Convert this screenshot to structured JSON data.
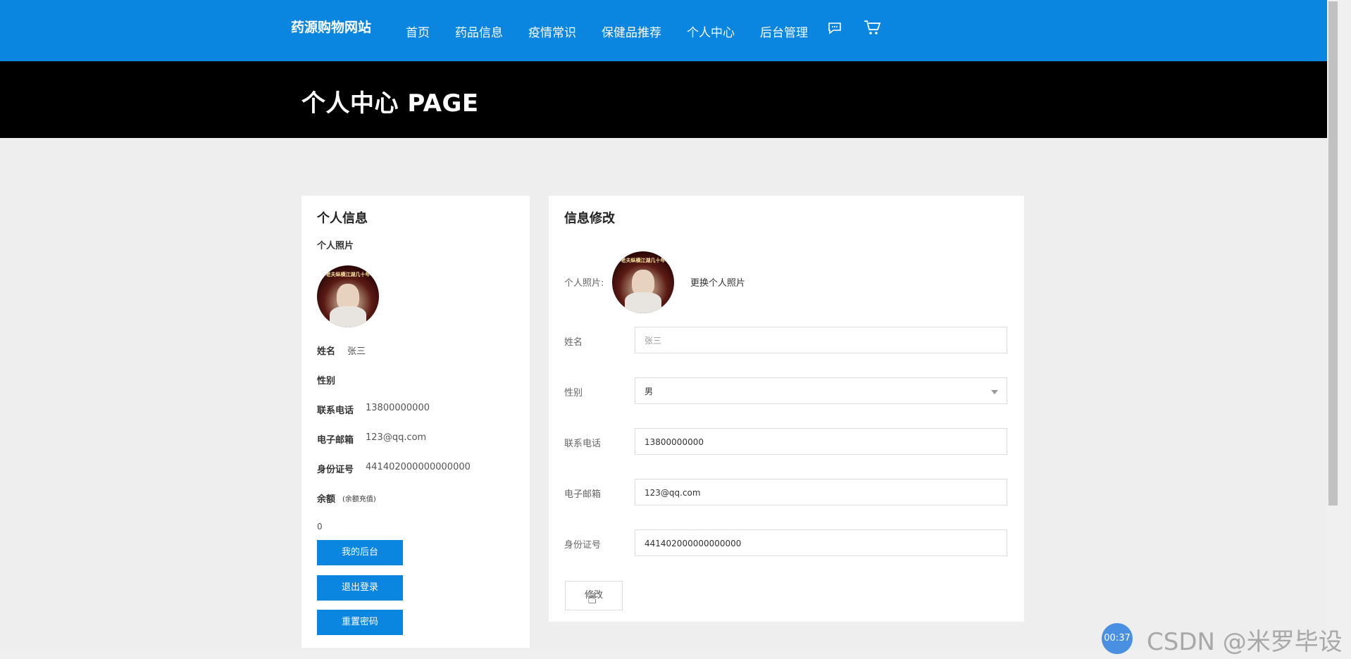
{
  "header": {
    "brand": "药源购物网站",
    "nav": [
      "首页",
      "药品信息",
      "疫情常识",
      "保健品推荐",
      "个人中心",
      "后台管理"
    ],
    "icons": [
      "chat-icon",
      "cart-icon"
    ]
  },
  "banner": {
    "title": "个人中心 PAGE"
  },
  "profile": {
    "title": "个人信息",
    "photo_label": "个人照片",
    "avatar_caption": "老夫纵横江湖几十年",
    "name_label": "姓名",
    "name": "张三",
    "gender_label": "性别",
    "gender": "",
    "phone_label": "联系电话",
    "phone": "13800000000",
    "email_label": "电子邮箱",
    "email": "123@qq.com",
    "id_label": "身份证号",
    "id": "441402000000000000",
    "balance_label": "余额",
    "recharge_link": "(余额充值)",
    "balance": "0",
    "buttons": {
      "backend": "我的后台",
      "logout": "退出登录",
      "reset": "重置密码"
    }
  },
  "edit": {
    "title": "信息修改",
    "photo_label": "个人照片:",
    "change_photo": "更换个人照片",
    "name_label": "姓名",
    "name_placeholder": "张三",
    "gender_label": "性别",
    "gender_value": "男",
    "phone_label": "联系电话",
    "phone_value": "13800000000",
    "email_label": "电子邮箱",
    "email_value": "123@qq.com",
    "id_label": "身份证号",
    "id_value": "441402000000000000",
    "submit": "修改"
  },
  "overlay": {
    "timer": "00:37",
    "watermark": "CSDN @米罗毕设"
  },
  "colors": {
    "nav": "#0b86e0",
    "banner": "#000000",
    "page_bg": "#eeeeee"
  }
}
